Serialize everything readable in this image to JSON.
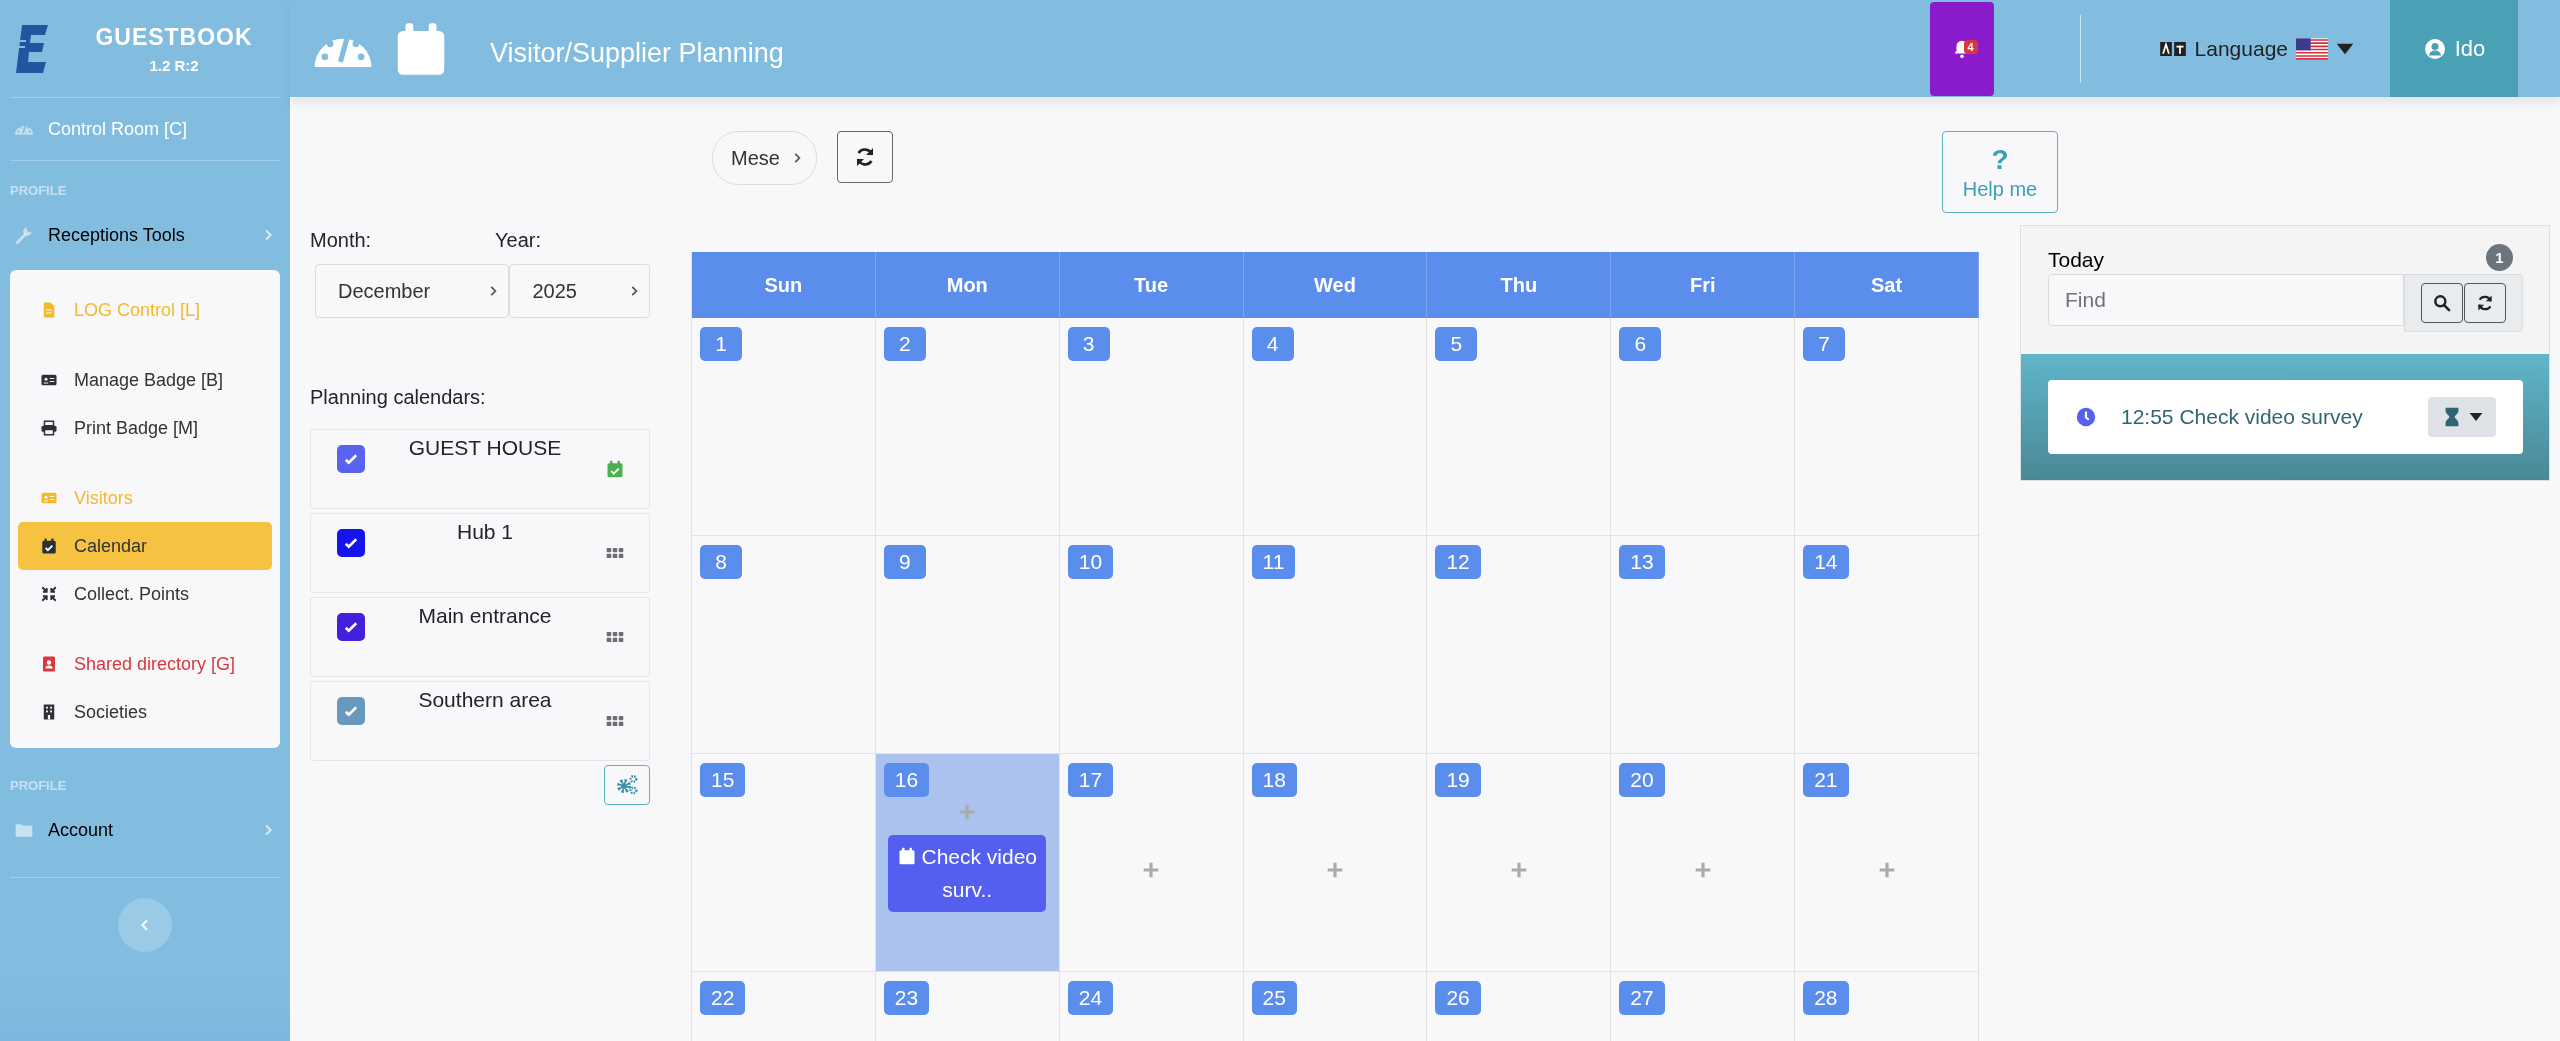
{
  "app": {
    "name": "GUESTBOOK",
    "version": "1.2 R:2"
  },
  "sidebar": {
    "top_items": [
      {
        "label": "Control Room [C]"
      }
    ],
    "sections": [
      {
        "title": "PROFILE",
        "items": [
          {
            "label": "Receptions Tools",
            "groups": [
              {
                "heading": {
                  "label": "LOG Control [L]",
                  "color": "#f2b92d"
                }
              },
              {
                "items": [
                  {
                    "label": "Manage Badge [B]",
                    "selected": false
                  },
                  {
                    "label": "Print Badge [M]",
                    "selected": false
                  }
                ]
              },
              {
                "heading": {
                  "label": "Visitors",
                  "color": "#f2b92d"
                },
                "items": [
                  {
                    "label": "Calendar",
                    "selected": true
                  },
                  {
                    "label": "Collect. Points",
                    "selected": false
                  }
                ]
              },
              {
                "heading": {
                  "label": "Shared directory [G]",
                  "color": "#d9373d"
                },
                "items": [
                  {
                    "label": "Societies",
                    "selected": false
                  }
                ]
              }
            ]
          }
        ]
      },
      {
        "title": "PROFILE",
        "items": [
          {
            "label": "Account"
          }
        ]
      }
    ]
  },
  "header": {
    "title": "Visitor/Supplier Planning",
    "notifications": {
      "count": "4"
    },
    "language": {
      "label": "Language"
    },
    "user": {
      "name": "Ido"
    }
  },
  "toolbar": {
    "view_select": {
      "value": "Mese"
    },
    "help": {
      "glyph": "?",
      "label": "Help me"
    }
  },
  "filters": {
    "month_label": "Month:",
    "month": "December",
    "year_label": "Year:",
    "year": "2025"
  },
  "planning": {
    "title": "Planning calendars:",
    "calendars": [
      {
        "name": "GUEST HOUSE",
        "checked": true,
        "color": "#5a62f0"
      },
      {
        "name": "Hub 1",
        "checked": true,
        "color": "#1414ee"
      },
      {
        "name": "Main entrance",
        "checked": true,
        "color": "#4420dd"
      },
      {
        "name": "Southern area",
        "checked": true,
        "color": "#6699bb"
      }
    ]
  },
  "calendar": {
    "weekdays": [
      "Sun",
      "Mon",
      "Tue",
      "Wed",
      "Thu",
      "Fri",
      "Sat"
    ],
    "weeks": [
      [
        {
          "day": "1",
          "selected": false,
          "add": false
        },
        {
          "day": "2",
          "selected": false,
          "add": false
        },
        {
          "day": "3",
          "selected": false,
          "add": false
        },
        {
          "day": "4",
          "selected": false,
          "add": false
        },
        {
          "day": "5",
          "selected": false,
          "add": false
        },
        {
          "day": "6",
          "selected": false,
          "add": false
        },
        {
          "day": "7",
          "selected": false,
          "add": false
        }
      ],
      [
        {
          "day": "8",
          "selected": false,
          "add": false
        },
        {
          "day": "9",
          "selected": false,
          "add": false
        },
        {
          "day": "10",
          "selected": false,
          "add": false
        },
        {
          "day": "11",
          "selected": false,
          "add": false
        },
        {
          "day": "12",
          "selected": false,
          "add": false
        },
        {
          "day": "13",
          "selected": false,
          "add": false
        },
        {
          "day": "14",
          "selected": false,
          "add": false
        }
      ],
      [
        {
          "day": "15",
          "selected": false,
          "add": false
        },
        {
          "day": "16",
          "selected": true,
          "add": true,
          "events": [
            {
              "title": "Check video surv.."
            }
          ]
        },
        {
          "day": "17",
          "selected": false,
          "add": true
        },
        {
          "day": "18",
          "selected": false,
          "add": true
        },
        {
          "day": "19",
          "selected": false,
          "add": true
        },
        {
          "day": "20",
          "selected": false,
          "add": true
        },
        {
          "day": "21",
          "selected": false,
          "add": true
        }
      ],
      [
        {
          "day": "22",
          "selected": false,
          "add": false
        },
        {
          "day": "23",
          "selected": false,
          "add": false
        },
        {
          "day": "24",
          "selected": false,
          "add": false
        },
        {
          "day": "25",
          "selected": false,
          "add": false
        },
        {
          "day": "26",
          "selected": false,
          "add": false
        },
        {
          "day": "27",
          "selected": false,
          "add": false
        },
        {
          "day": "28",
          "selected": false,
          "add": false
        }
      ]
    ]
  },
  "today": {
    "title": "Today",
    "count": "1",
    "search": {
      "placeholder": "Find"
    },
    "items": [
      {
        "text": "12:55 Check video survey"
      }
    ]
  }
}
